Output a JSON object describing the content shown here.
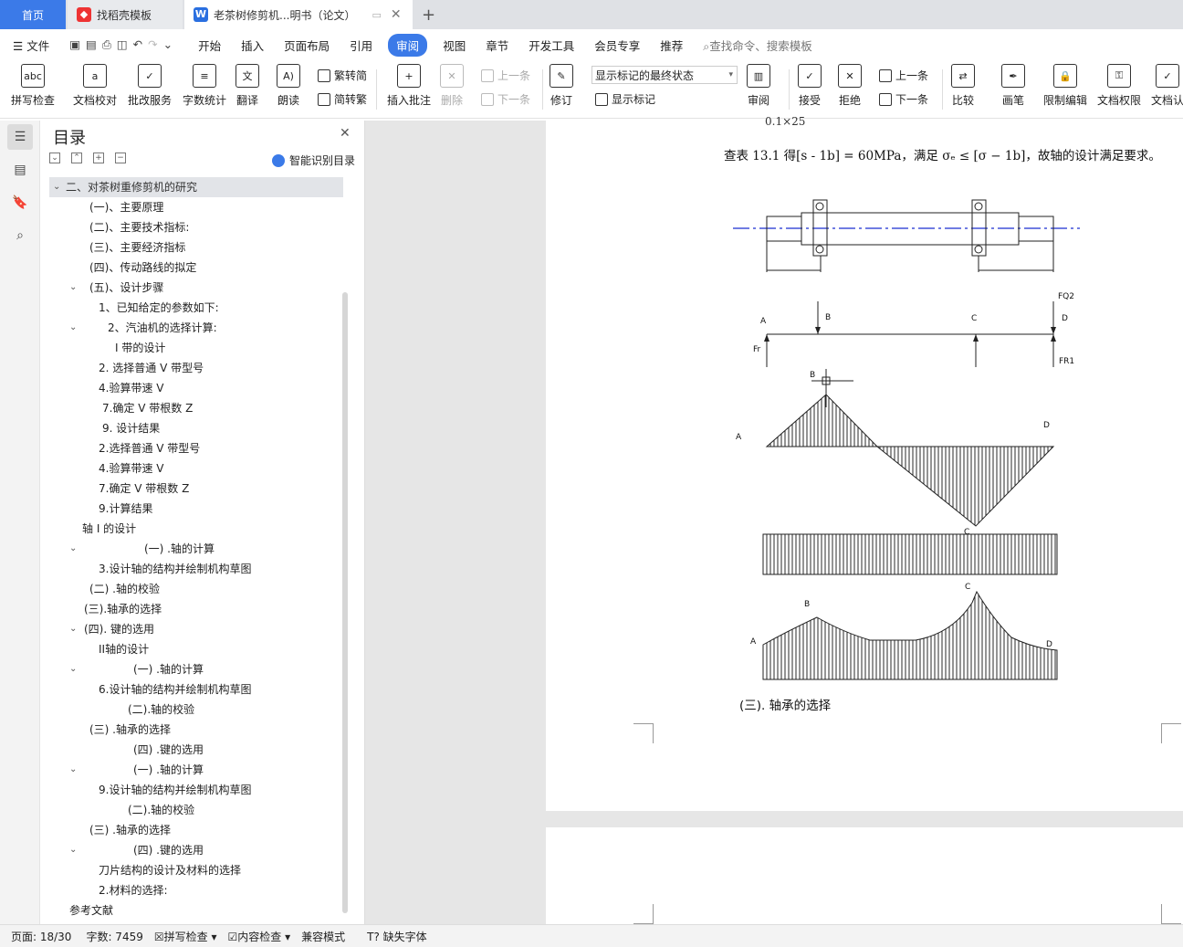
{
  "tabs": {
    "home": "首页",
    "tab1": "找稻壳模板",
    "tab2": "老茶树修剪机...明书（论文）",
    "new_tab": "+"
  },
  "menubar": {
    "file": "文件",
    "items": [
      "开始",
      "插入",
      "页面布局",
      "引用",
      "审阅",
      "视图",
      "章节",
      "开发工具",
      "会员专享",
      "推荐"
    ],
    "active": "审阅",
    "search_placeholder": "查找命令、搜索模板"
  },
  "ribbon": {
    "spellcheck": "拼写检查",
    "doc_proof": "文档校对",
    "revise_service": "批改服务",
    "word_count": "字数统计",
    "translate": "翻译",
    "read_aloud": "朗读",
    "trad_conv": "繁转简",
    "simp_conv": "简转繁",
    "insert_comment": "插入批注",
    "delete": "删除",
    "prev": "上一条",
    "next": "下一条",
    "track": "修订",
    "markup_state": "显示标记的最终状态",
    "show_markup": "显示标记",
    "review": "审阅",
    "accept": "接受",
    "reject": "拒绝",
    "prev2": "上一条",
    "next2": "下一条",
    "compare": "比较",
    "pen": "画笔",
    "restrict": "限制编辑",
    "permission": "文档权限",
    "doc_cert": "文档认"
  },
  "toc": {
    "title": "目录",
    "smart": "智能识别目录",
    "items": [
      {
        "text": "二、对茶树重修剪机的研究",
        "indent": 0,
        "chev": true,
        "sel": true
      },
      {
        "text": "(一)、主要原理",
        "indent": 44
      },
      {
        "text": "(二)、主要技术指标:",
        "indent": 44
      },
      {
        "text": "(三)、主要经济指标",
        "indent": 44
      },
      {
        "text": "(四)、传动路线的拟定",
        "indent": 44
      },
      {
        "text": "(五)、设计步骤",
        "indent": 44,
        "chev": true
      },
      {
        "text": "1、已知给定的参数如下:",
        "indent": 54
      },
      {
        "text": "2、汽油机的选择计算:",
        "indent": 64,
        "chev": true
      },
      {
        "text": "I 带的设计",
        "indent": 72
      },
      {
        "text": "2. 选择普通 V 带型号",
        "indent": 54
      },
      {
        "text": "4.验算带速 V",
        "indent": 54
      },
      {
        "text": "7.确定 V 带根数 Z",
        "indent": 58
      },
      {
        "text": "9. 设计结果",
        "indent": 58
      },
      {
        "text": "2.选择普通 V 带型号",
        "indent": 54
      },
      {
        "text": "4.验算带速 V",
        "indent": 54
      },
      {
        "text": "7.确定 V 带根数 Z",
        "indent": 54
      },
      {
        "text": "9.计算结果",
        "indent": 54
      },
      {
        "text": "轴 I 的设计",
        "indent": 36
      },
      {
        "text": "(一) .轴的计算",
        "indent": 104,
        "chev": true
      },
      {
        "text": "3.设计轴的结构并绘制机构草图",
        "indent": 54
      },
      {
        "text": "(二) .轴的校验",
        "indent": 44
      },
      {
        "text": "(三).轴承的选择",
        "indent": 38
      },
      {
        "text": "(四). 键的选用",
        "indent": 38,
        "chev": true
      },
      {
        "text": "II轴的设计",
        "indent": 54
      },
      {
        "text": "(一) .轴的计算",
        "indent": 92,
        "chev": true
      },
      {
        "text": "6.设计轴的结构并绘制机构草图",
        "indent": 54
      },
      {
        "text": "(二).轴的校验",
        "indent": 86
      },
      {
        "text": "(三) .轴承的选择",
        "indent": 44
      },
      {
        "text": "(四) .键的选用",
        "indent": 92
      },
      {
        "text": "(一) .轴的计算",
        "indent": 92,
        "chev": true
      },
      {
        "text": "9.设计轴的结构并绘制机构草图",
        "indent": 54
      },
      {
        "text": "(二).轴的校验",
        "indent": 86
      },
      {
        "text": "(三) .轴承的选择",
        "indent": 44
      },
      {
        "text": "(四) .键的选用",
        "indent": 92,
        "chev": true
      },
      {
        "text": "刀片结构的设计及材料的选择",
        "indent": 54
      },
      {
        "text": "2.材料的选择:",
        "indent": 54
      },
      {
        "text": "参考文献",
        "indent": 22
      }
    ]
  },
  "document": {
    "top_cut": "0.1×25",
    "line1": "查表 13.1 得[s - 1b] = 60MPa，满足 σₑ ≤ [σ − 1b]，故轴的设计满足要求。",
    "caption": "(三). 轴承的选择",
    "labels": {
      "A": "A",
      "B": "B",
      "C": "C",
      "D": "D",
      "FQ2": "FQ2",
      "Fr": "Fr",
      "FR1": "FR1"
    }
  },
  "status": {
    "page": "页面: 18/30",
    "words": "字数: 7459",
    "spell": "拼写检查",
    "content": "内容检查",
    "compat": "兼容模式",
    "missing_font": "缺失字体"
  }
}
